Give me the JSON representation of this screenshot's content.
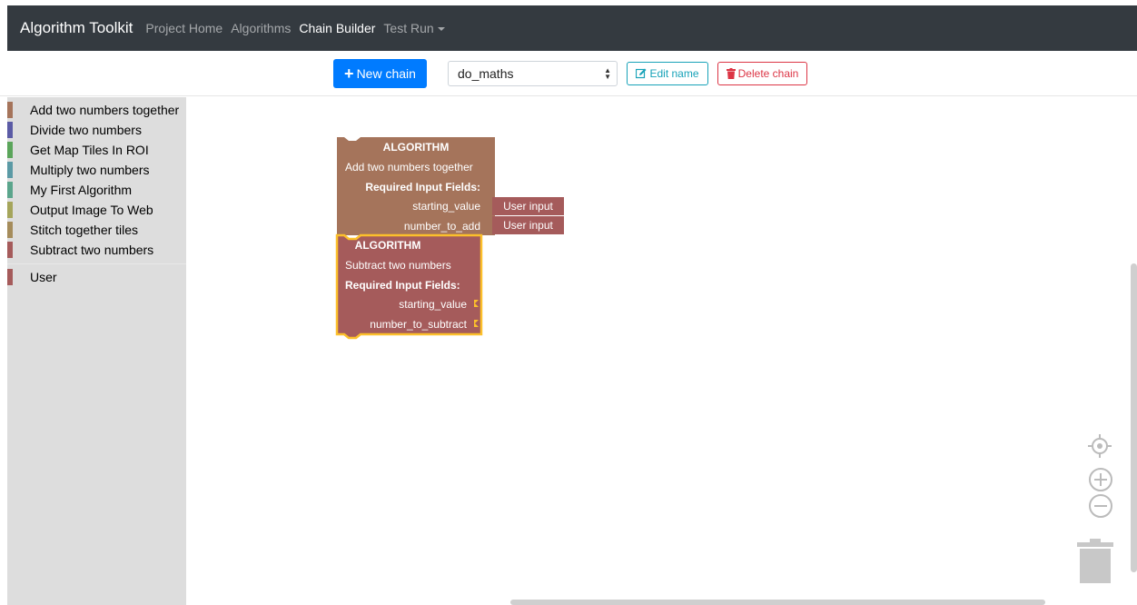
{
  "navbar": {
    "brand": "Algorithm Toolkit",
    "links": [
      "Project Home",
      "Algorithms",
      "Chain Builder",
      "Test Run"
    ],
    "active": "Chain Builder"
  },
  "toolbar": {
    "new_chain_label": "New chain",
    "chain_select_value": "do_maths",
    "edit_name_label": "Edit name",
    "delete_chain_label": "Delete chain"
  },
  "sidebar": {
    "categories": [
      {
        "label": "Add two numbers together",
        "color": "#a5745b"
      },
      {
        "label": "Divide two numbers",
        "color": "#5b5ba5"
      },
      {
        "label": "Get Map Tiles In ROI",
        "color": "#5ba55b"
      },
      {
        "label": "Multiply two numbers",
        "color": "#5b9aa5"
      },
      {
        "label": "My First Algorithm",
        "color": "#5ba58c"
      },
      {
        "label": "Output Image To Web",
        "color": "#a5a55b"
      },
      {
        "label": "Stitch together tiles",
        "color": "#a58c5b"
      },
      {
        "label": "Subtract two numbers",
        "color": "#a55b5b"
      }
    ],
    "user_category": {
      "label": "User",
      "color": "#a55b5b"
    }
  },
  "blocks": {
    "add": {
      "header": "ALGORITHM",
      "name": "Add two numbers together",
      "required": "Required Input Fields:",
      "field1": "starting_value",
      "field2": "number_to_add",
      "input1": "User input",
      "input2": "User input",
      "color": "#a5745b"
    },
    "subtract": {
      "header": "ALGORITHM",
      "name": "Subtract two numbers",
      "required": "Required Input Fields:",
      "field1": "starting_value",
      "field2": "number_to_subtract",
      "color": "#a55b5b",
      "highlight": "#fcc02b"
    }
  },
  "icons": {
    "new_chain": "plus-icon",
    "edit_name": "edit-icon",
    "delete_chain": "trash-icon",
    "recenter": "crosshair-icon",
    "zoom_in": "zoom-in-icon",
    "zoom_out": "zoom-out-icon",
    "trashcan": "trashcan-icon"
  }
}
